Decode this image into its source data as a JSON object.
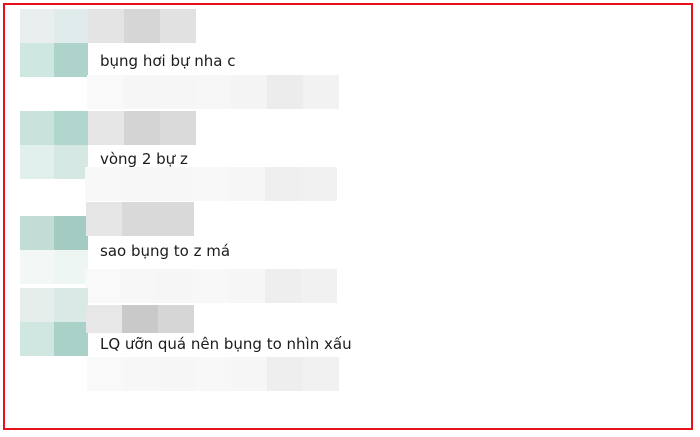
{
  "comments": [
    {
      "text": "bụng hơi bự nha c"
    },
    {
      "text": "vòng 2 bự z"
    },
    {
      "text": "sao bụng to z má"
    },
    {
      "text": "LQ ưỡn quá nên bụng to nhìn xấu"
    }
  ],
  "colors": {
    "border": "#e8101a",
    "avatar_teal_dark": "#a9d1c8",
    "avatar_teal_light": "#e3f1ee",
    "blur_gray": "#dcdcdc",
    "blur_light": "#f4f4f4"
  }
}
